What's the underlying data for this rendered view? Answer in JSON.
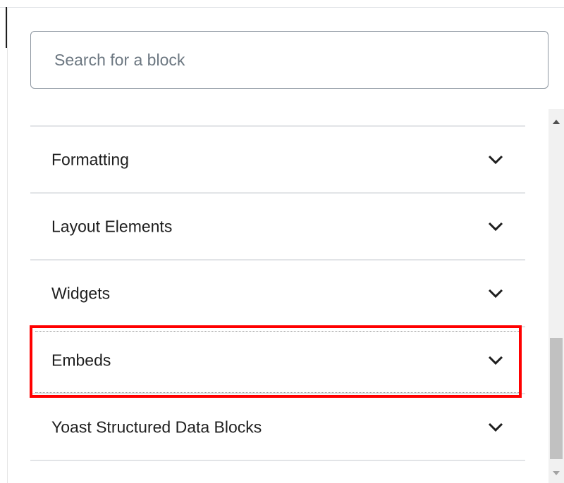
{
  "search": {
    "placeholder": "Search for a block",
    "value": ""
  },
  "categories": [
    {
      "label": "Formatting",
      "icon": "chevron-down-icon",
      "expanded": false
    },
    {
      "label": "Layout Elements",
      "icon": "chevron-down-icon",
      "expanded": false
    },
    {
      "label": "Widgets",
      "icon": "chevron-down-icon",
      "expanded": false
    },
    {
      "label": "Embeds",
      "icon": "chevron-down-icon",
      "expanded": false,
      "highlighted": true
    },
    {
      "label": "Yoast Structured Data Blocks",
      "icon": "chevron-down-icon",
      "expanded": false
    }
  ],
  "scrollbar": {
    "up_icon": "triangle-up-icon",
    "down_icon": "triangle-down-icon",
    "position": 0.88
  },
  "colors": {
    "highlight": "#ff0000",
    "text": "#1e1e1e",
    "placeholder": "#6c7781",
    "divider": "#e2e4e7",
    "input_border": "#8d96a0"
  }
}
